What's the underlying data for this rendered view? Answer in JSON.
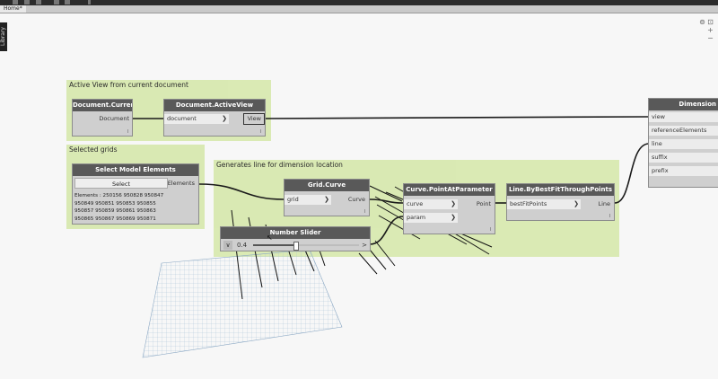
{
  "window": {
    "tab_label": "Home*",
    "library_label": "Library"
  },
  "icons": [
    "file-icon",
    "folder-icon",
    "save-icon",
    "undo-icon",
    "redo-icon",
    "zoom-icon",
    "view-toggle-icon",
    "fit-icon",
    "plus-icon",
    "minus-icon",
    "mouse-cursor-icon"
  ],
  "groups": {
    "active_view": "Active View from current document",
    "selected_grids": "Selected grids",
    "dimension_line": "Generates line for dimension location"
  },
  "nodes": {
    "doc_current": {
      "title": "Document.Current",
      "output": "Document",
      "badge": "l"
    },
    "doc_activeview": {
      "title": "Document.ActiveView",
      "input": "document",
      "output": "View",
      "badge": "l"
    },
    "select_model": {
      "title": "Select Model Elements",
      "button": "Select",
      "output": "Elements",
      "elements_lines": [
        "Elements : 250156 950828 950847",
        "950849 950851 950853 950855",
        "950857 950859 950861 950863",
        "950865 950867 950869 950871"
      ]
    },
    "grid_curve": {
      "title": "Grid.Curve",
      "input": "grid",
      "output": "Curve",
      "badge": "l"
    },
    "number_slider": {
      "title": "Number Slider",
      "value": "0.4",
      "level": 0.4,
      "minus": "∨",
      "chevron": ">"
    },
    "point_at_param": {
      "title": "Curve.PointAtParameter",
      "inputs": [
        "curve",
        "param"
      ],
      "output": "Point",
      "badge": "l"
    },
    "best_fit": {
      "title": "Line.ByBestFitThroughPoints",
      "input": "bestFitPoints",
      "output": "Line",
      "badge": "l"
    },
    "dimension": {
      "title": "Dimension",
      "inputs": [
        "view",
        "referenceElements",
        "line",
        "suffix",
        "prefix"
      ]
    }
  },
  "colors": {
    "group_fill": "#d8e9b0",
    "node_header": "#595959",
    "node_body": "#cfcfcf",
    "wire": "#1a1a1a",
    "canvas": "#f7f7f7"
  }
}
